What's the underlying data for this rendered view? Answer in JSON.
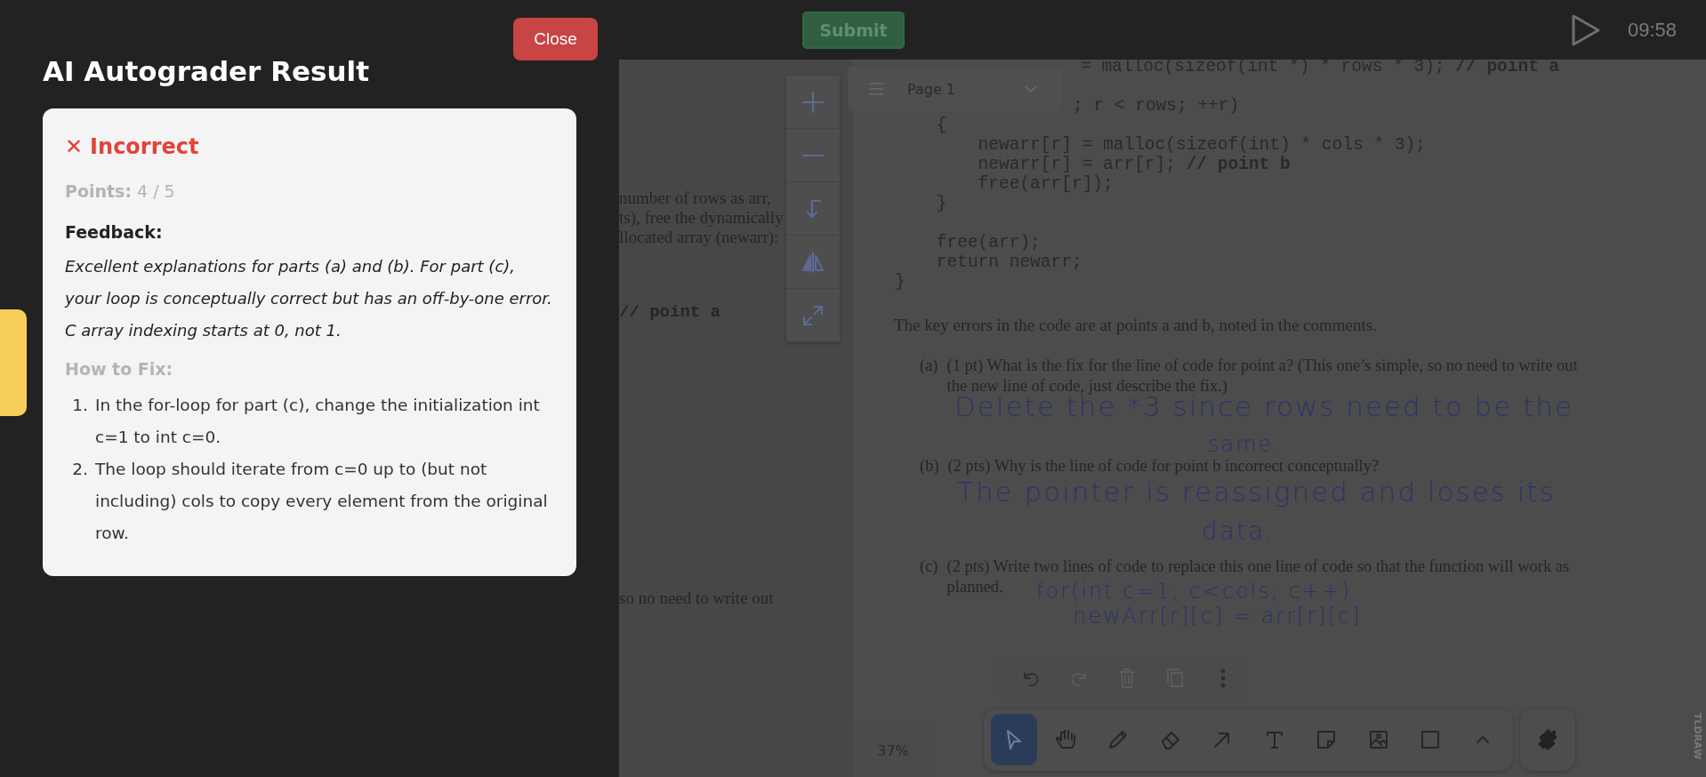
{
  "top_bar": {
    "submit_button": "Submit",
    "timer": "09:58"
  },
  "result_panel": {
    "title": "AI Autograder Result",
    "close_button": "Close",
    "verdict": {
      "kind": "incorrect",
      "mark": "✕",
      "label": "Incorrect"
    },
    "points_label": "Points:",
    "points_value": "4 / 5",
    "feedback_label": "Feedback:",
    "feedback": "Excellent explanations for parts (a) and (b). For part (c), your loop is conceptually correct but has an off-by-one error. C array indexing starts at 0, not 1.",
    "fix_label": "How to Fix:",
    "fix_steps": [
      {
        "marker": "1.",
        "text": "In the for-loop for part (c), change the initialization int c=1 to int c=0."
      },
      {
        "marker": "2.",
        "text": "The loop should iterate from c=0 up to (but not including) cols to copy every element from the original row."
      }
    ]
  },
  "side_tab": {
    "kind": "tab"
  },
  "document": {
    "page_selector": "Page 1",
    "zoom_level": "37%",
    "brand": "TLDRAW",
    "left_page_lines": [
      {
        "text": "number of rows as arr,",
        "kind": "prose"
      },
      {
        "text": "ts), free the dynamically",
        "kind": "prose"
      },
      {
        "text": "llocated array (newarr):",
        "kind": "prose"
      },
      {
        "text": "// point a",
        "kind": "code"
      },
      {
        "text": "so no need to write out",
        "kind": "prose"
      }
    ],
    "code_lines": [
      {
        "kind": "cut",
        "code": "= malloc(sizeof(int *) * rows * 3); ",
        "comment": "// point a"
      },
      {
        "kind": "cut",
        "code": "; r < rows; ++r)"
      },
      {
        "kind": "full",
        "code": "    {"
      },
      {
        "kind": "full",
        "code": "        newarr[r] = malloc(sizeof(int) * cols * 3);"
      },
      {
        "kind": "full",
        "code": "        newarr[r] = arr[r]; ",
        "comment": "// point b"
      },
      {
        "kind": "full",
        "code": "        free(arr[r]);"
      },
      {
        "kind": "full",
        "code": "    }"
      },
      {
        "kind": "full",
        "code": "    free(arr);"
      },
      {
        "kind": "full",
        "code": "    return newarr;"
      },
      {
        "kind": "full",
        "code": "}"
      }
    ],
    "intro": "The key errors in the code are at points a and b, noted in the comments.",
    "questions": [
      {
        "label": "(a)",
        "lines": [
          "(1 pt) What is the fix for the line of code for point a? (This one’s simple, so no need to write out",
          "the new line of code, just describe the fix.)"
        ]
      },
      {
        "label": "(b)",
        "lines": [
          "(2 pts) Why is the line of code for point b incorrect conceptually?"
        ]
      },
      {
        "label": "(c)",
        "lines": [
          "(2 pts) Write two lines of code to replace this one line of code so that the function will work as",
          "planned."
        ]
      }
    ],
    "handwriting": [
      "Delete the *3 since rows need to be the",
      "same.",
      "The pointer is reassigned and loses its",
      "data.",
      "for(int c=1; c<cols; c++)",
      "newArr[r][c] = arr[r][c]"
    ],
    "view_tools": [
      {
        "kind": "zoom-in"
      },
      {
        "kind": "zoom-out"
      },
      {
        "kind": "rotate"
      },
      {
        "kind": "flip"
      },
      {
        "kind": "fit"
      }
    ],
    "edit_actions": [
      {
        "kind": "undo",
        "disabled": false
      },
      {
        "kind": "redo",
        "disabled": true
      },
      {
        "kind": "delete",
        "disabled": true
      },
      {
        "kind": "duplicate",
        "disabled": true
      },
      {
        "kind": "more",
        "disabled": false
      }
    ],
    "tools": [
      {
        "kind": "select",
        "selected": true
      },
      {
        "kind": "hand",
        "selected": false
      },
      {
        "kind": "draw",
        "selected": false
      },
      {
        "kind": "eraser",
        "selected": false
      },
      {
        "kind": "arrow",
        "selected": false
      },
      {
        "kind": "text",
        "selected": false
      },
      {
        "kind": "note",
        "selected": false
      },
      {
        "kind": "image",
        "selected": false
      },
      {
        "kind": "rectangle",
        "selected": false
      },
      {
        "kind": "more",
        "selected": false
      }
    ]
  }
}
